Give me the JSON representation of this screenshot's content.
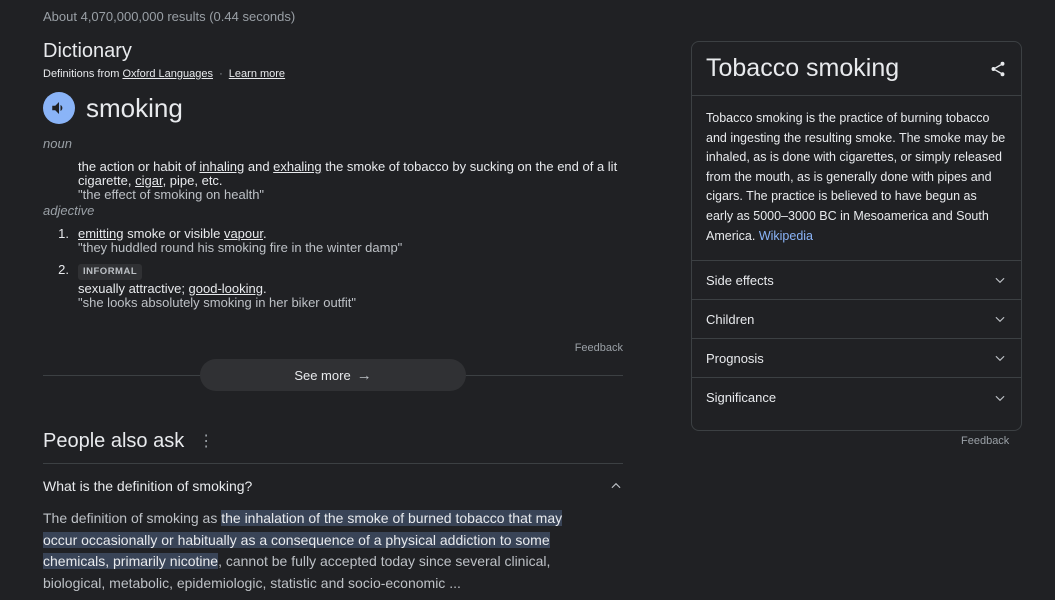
{
  "result_stats": "About 4,070,000,000 results (0.44 seconds)",
  "dictionary": {
    "title": "Dictionary",
    "source_prefix": "Definitions from",
    "source_name": "Oxford Languages",
    "separator": "·",
    "learn_more": "Learn more",
    "headword": "smoking",
    "noun": {
      "pos": "noun",
      "def_a": "the action or habit of ",
      "link1": "inhaling",
      "def_b": " and ",
      "link2": "exhaling",
      "def_c": " the smoke of tobacco by sucking on the end of a lit cigarette, ",
      "link3": "cigar",
      "def_d": ", pipe, etc.",
      "example": "\"the effect of smoking on health\""
    },
    "adjective": {
      "pos": "adjective",
      "items": [
        {
          "num": "1.",
          "link": "emitting",
          "def_a": " smoke or visible ",
          "link2": "vapour",
          "def_b": ".",
          "example": "\"they huddled round his smoking fire in the winter damp\""
        },
        {
          "num": "2.",
          "badge": "INFORMAL",
          "def_a": "sexually attractive; ",
          "link": "good-looking",
          "def_b": ".",
          "example": "\"she looks absolutely smoking in her biker outfit\""
        }
      ]
    },
    "feedback": "Feedback",
    "see_more": "See more"
  },
  "people_also_ask": {
    "title": "People also ask",
    "question": "What is the definition of smoking?",
    "answer_prefix": "The definition of smoking as ",
    "answer_highlight": "the inhalation of the smoke of burned tobacco that may occur occasionally or habitually as a consequence of a physical addiction to some chemicals, primarily nicotine",
    "answer_suffix": ", cannot be fully accepted today since several clinical, biological, metabolic, epidemiologic, statistic and socio-economic ..."
  },
  "knowledge_panel": {
    "title": "Tobacco smoking",
    "description": "Tobacco smoking is the practice of burning tobacco and ingesting the resulting smoke. The smoke may be inhaled, as is done with cigarettes, or simply released from the mouth, as is generally done with pipes and cigars. The practice is believed to have begun as early as 5000–3000 BC in Mesoamerica and South America.",
    "source_link": "Wikipedia",
    "rows": [
      "Side effects",
      "Children",
      "Prognosis",
      "Significance"
    ],
    "feedback": "Feedback"
  },
  "colors": {
    "background": "#202124",
    "accent_blue": "#8ab4f8",
    "highlight": "#394457"
  }
}
